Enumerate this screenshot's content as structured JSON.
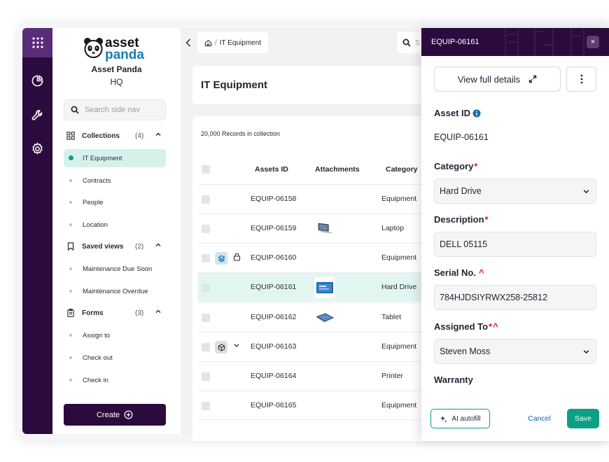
{
  "colors": {
    "rail": "#2b0a3d",
    "rail_active": "#5a2d79",
    "accent": "#0c9f86",
    "active_nav_bg": "#d6f1ec",
    "required": "#d11a3b",
    "link": "#1a5ea8"
  },
  "brand": {
    "logo_line1": "asset",
    "logo_line2": "panda",
    "org_name": "Asset Panda",
    "org_sub": "HQ"
  },
  "rail": {
    "icons": [
      "apps-grid-icon",
      "pie-chart-icon",
      "wrench-icon",
      "gear-icon"
    ]
  },
  "sidenav": {
    "search_placeholder": "Search side nav",
    "collections": {
      "label": "Collections",
      "count": "(4)"
    },
    "collection_items": [
      "IT Equipment",
      "Contracts",
      "People",
      "Location"
    ],
    "saved_views": {
      "label": "Saved views",
      "count": "(2)"
    },
    "saved_view_items": [
      "Maintenance Due Soon",
      "Maintenance Overdue"
    ],
    "forms": {
      "label": "Forms",
      "count": "(3)"
    },
    "form_items": [
      "Assign to",
      "Check out",
      "Check in"
    ],
    "create_label": "Create"
  },
  "main": {
    "breadcrumb": "IT Equipment",
    "breadcrumb_sep": "/",
    "search_placeholder": "S",
    "title": "IT Equipment",
    "records_label": "20,000 Records in collection",
    "columns": [
      "Assets ID",
      "Attachments",
      "Category"
    ],
    "rows": [
      {
        "id": "EQUIP-06158",
        "category": "Equipment",
        "attachment": ""
      },
      {
        "id": "EQUIP-06159",
        "category": "Laptop",
        "attachment": "laptop"
      },
      {
        "id": "EQUIP-06160",
        "category": "Equipment",
        "attachment": ""
      },
      {
        "id": "EQUIP-06161",
        "category": "Hard Drive",
        "attachment": "drive"
      },
      {
        "id": "EQUIP-06162",
        "category": "Tablet",
        "attachment": "tablet"
      },
      {
        "id": "EQUIP-06163",
        "category": "Equipment",
        "attachment": ""
      },
      {
        "id": "EQUIP-06164",
        "category": "Printer",
        "attachment": ""
      },
      {
        "id": "EQUIP-06165",
        "category": "Equipment",
        "attachment": ""
      }
    ]
  },
  "drawer": {
    "title": "EQUIP-06161",
    "close_label": "×",
    "view_full_label": "View full details",
    "asset_id_label": "Asset ID",
    "asset_id_value": "EQUIP-06161",
    "category_label": "Category",
    "category_value": "Hard Drive",
    "description_label": "Description",
    "description_value": "DELL 05115",
    "serial_label": "Serial No.",
    "serial_value": "784HJDSIYRWX258-25812",
    "assigned_label": "Assigned To",
    "assigned_value": "Steven Moss",
    "warranty_label": "Warranty",
    "required_mark": "*",
    "unique_mark": "^",
    "ai_label": "AI autofill",
    "cancel_label": "Cancel",
    "save_label": "Save"
  }
}
